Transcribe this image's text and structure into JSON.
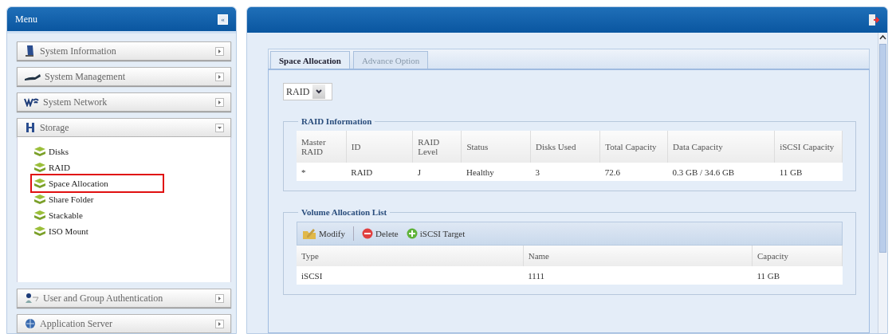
{
  "menu": {
    "title": "Menu",
    "collapse_label": "«",
    "sections": [
      {
        "label": "System Information",
        "expanded": false
      },
      {
        "label": "System Management",
        "expanded": false
      },
      {
        "label": "System Network",
        "expanded": false
      },
      {
        "label": "Storage",
        "expanded": true,
        "children": [
          {
            "label": "Disks",
            "selected": false
          },
          {
            "label": "RAID",
            "selected": false
          },
          {
            "label": "Space Allocation",
            "selected": true
          },
          {
            "label": "Share Folder",
            "selected": false
          },
          {
            "label": "Stackable",
            "selected": false
          },
          {
            "label": "ISO Mount",
            "selected": false
          }
        ]
      },
      {
        "label": "User and Group Authentication",
        "expanded": false
      },
      {
        "label": "Application Server",
        "expanded": false
      }
    ]
  },
  "tabs": [
    {
      "label": "Space Allocation",
      "selected": true
    },
    {
      "label": "Advance Option",
      "selected": false
    }
  ],
  "raid_select": {
    "value": "RAID"
  },
  "raid_info": {
    "title": "RAID Information",
    "columns": [
      "Master RAID",
      "ID",
      "RAID Level",
      "Status",
      "Disks Used",
      "Total Capacity",
      "Data Capacity",
      "iSCSI Capacity"
    ],
    "rows": [
      [
        "*",
        "RAID",
        "J",
        "Healthy",
        "3",
        "72.6",
        "0.3 GB / 34.6 GB",
        "11 GB"
      ]
    ]
  },
  "volume_list": {
    "title": "Volume Allocation List",
    "toolbar": [
      {
        "kind": "modify",
        "label": "Modify"
      },
      {
        "kind": "delete",
        "label": "Delete"
      },
      {
        "kind": "add",
        "label": "iSCSI Target"
      }
    ],
    "columns": [
      "Type",
      "Name",
      "Capacity"
    ],
    "rows": [
      [
        "iSCSI",
        "1111",
        "11 GB"
      ]
    ]
  }
}
